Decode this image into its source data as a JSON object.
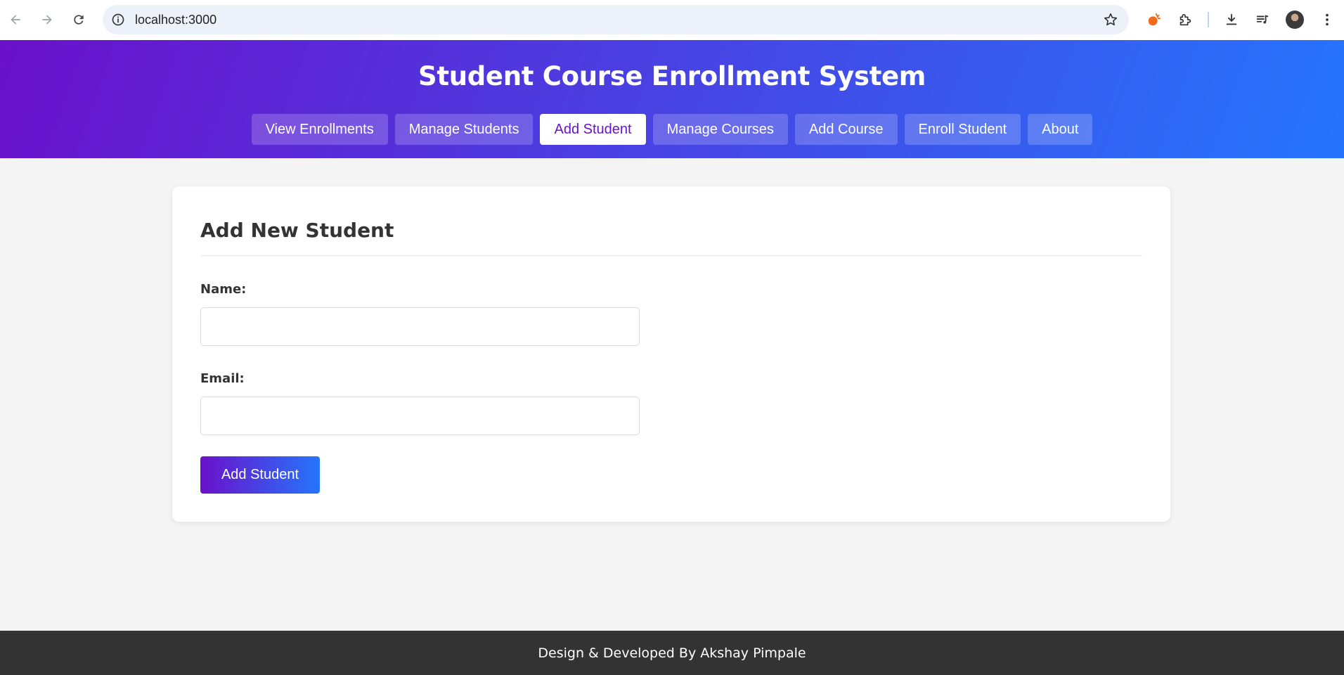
{
  "browser": {
    "url": "localhost:3000",
    "icons": [
      "back-icon",
      "forward-icon",
      "reload-icon",
      "site-info-icon",
      "bookmark-star-icon",
      "extension-brand-icon",
      "extensions-puzzle-icon",
      "download-icon",
      "media-control-icon",
      "profile-avatar",
      "more-menu-icon"
    ]
  },
  "header": {
    "title": "Student Course Enrollment System",
    "nav": [
      {
        "label": "View Enrollments",
        "active": false
      },
      {
        "label": "Manage Students",
        "active": false
      },
      {
        "label": "Add Student",
        "active": true
      },
      {
        "label": "Manage Courses",
        "active": false
      },
      {
        "label": "Add Course",
        "active": false
      },
      {
        "label": "Enroll Student",
        "active": false
      },
      {
        "label": "About",
        "active": false
      }
    ]
  },
  "form": {
    "title": "Add New Student",
    "name_label": "Name:",
    "name_value": "",
    "email_label": "Email:",
    "email_value": "",
    "submit_label": "Add Student"
  },
  "footer": {
    "text": "Design & Developed By Akshay Pimpale"
  },
  "colors": {
    "gradient_start": "#6a11cb",
    "gradient_end": "#2575fc",
    "page_bg": "#f4f4f4",
    "footer_bg": "#333333"
  }
}
